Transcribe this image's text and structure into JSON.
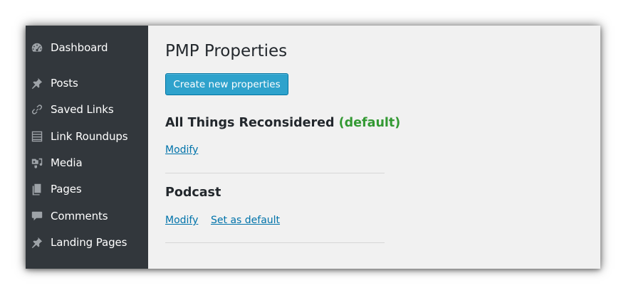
{
  "sidebar": {
    "items": [
      {
        "label": "Dashboard",
        "icon": "dashboard-icon"
      },
      {
        "label": "Posts",
        "icon": "pushpin-icon"
      },
      {
        "label": "Saved Links",
        "icon": "link-icon"
      },
      {
        "label": "Link Roundups",
        "icon": "list-icon"
      },
      {
        "label": "Media",
        "icon": "media-icon"
      },
      {
        "label": "Pages",
        "icon": "pages-icon"
      },
      {
        "label": "Comments",
        "icon": "comment-icon"
      },
      {
        "label": "Landing Pages",
        "icon": "pushpin-icon"
      }
    ]
  },
  "main": {
    "title": "PMP Properties",
    "create_button_label": "Create new properties",
    "properties": [
      {
        "name": "All Things Reconsidered",
        "default_tag": "(default)",
        "actions": [
          "Modify"
        ]
      },
      {
        "name": "Podcast",
        "default_tag": "",
        "actions": [
          "Modify",
          "Set as default"
        ]
      }
    ]
  },
  "colors": {
    "sidebar_bg": "#32373c",
    "sidebar_icon": "#9ea3a8",
    "content_bg": "#f1f1f1",
    "button_bg": "#2ea2cc",
    "link": "#0073aa",
    "default_tag": "#339933"
  }
}
